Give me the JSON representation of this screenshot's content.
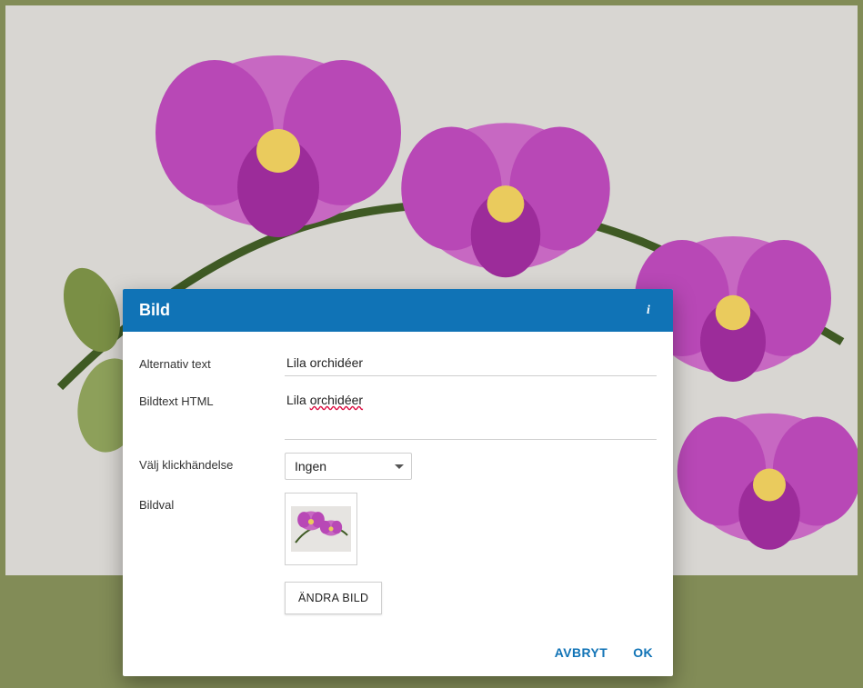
{
  "dialog": {
    "title": "Bild",
    "info_icon": "i",
    "fields": {
      "alt_text": {
        "label": "Alternativ text",
        "value": "Lila orchidéer"
      },
      "caption_html": {
        "label": "Bildtext HTML",
        "value_prefix": "Lila ",
        "value_wavy": "orchidéer"
      },
      "click_event": {
        "label": "Välj klickhändelse",
        "selected": "Ingen"
      },
      "image_select": {
        "label": "Bildval",
        "change_button": "ÄNDRA BILD"
      }
    },
    "actions": {
      "cancel": "AVBRYT",
      "ok": "OK"
    }
  },
  "colors": {
    "page_bg": "#828c57",
    "header_bg": "#1073b6",
    "accent": "#1073b6"
  }
}
